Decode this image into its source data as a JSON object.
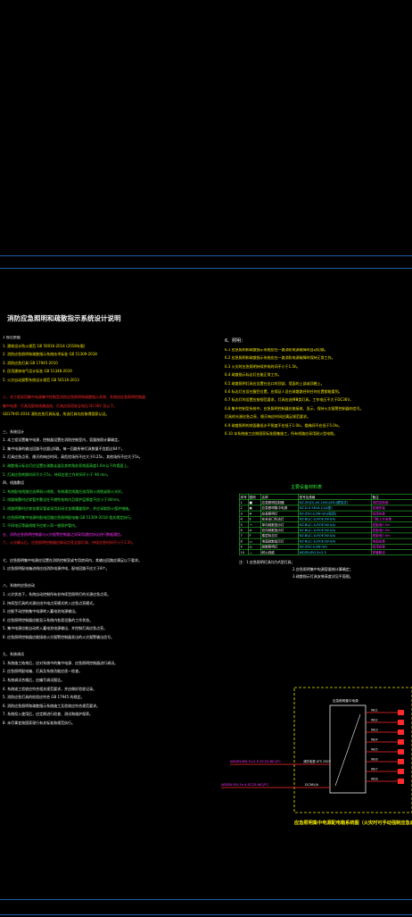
{
  "left_column": {
    "title": "消防应急照明和疏散指示系统设计说明",
    "lines": [
      {
        "text": "1 规范依据",
        "color": "w"
      },
      {
        "text": "1. 建筑设计防火规范 GB 50016-2014 (2018年版)",
        "color": "y"
      },
      {
        "text": "2. 消防应急照明和疏散指示系统技术标准 GB 51309-2018",
        "color": "y"
      },
      {
        "text": "3. 消防应急灯具 GB 17945-2010",
        "color": "y"
      },
      {
        "text": "4. 民用建筑电气设计标准 GB 51348-2019",
        "color": "y"
      },
      {
        "text": "5. 火灾自动报警系统设计规范 GB 50116-2013",
        "color": "y"
      },
      {
        "text": "",
        "color": "w"
      },
      {
        "text": "二、本工程采用集中电源集中控制型消防应急照明和疏散指示系统，系统由应急照明控制器",
        "color": "r"
      },
      {
        "text": "集中电源、灯具及配电线路组成，灯具应采用安全电压 DC36V 及以下。",
        "color": "r"
      },
      {
        "text": "GB17945-2010 消防应急灯具标准，所选灯具均应取得国家认证。",
        "color": "y"
      },
      {
        "text": "",
        "color": "w"
      },
      {
        "text": "三、系统设计",
        "color": "w"
      },
      {
        "text": "1. 本工程设置集中电源，控制器设置在消防控制室内，容量按照计算确定。",
        "color": "w"
      },
      {
        "text": "2. 集中电源的输出回路不应超过8路，每一回路所带灯具数量不宜超过64个。",
        "color": "w"
      },
      {
        "text": "3. 灯具应急点亮、熄灭的响应时间，高危险场所不应大于0.25s，其他场所不应大于5s。",
        "color": "w"
      },
      {
        "text": "4. 疏散指示标志灯应设置在疏散走道及其转角处距地面高度1.0m以下的墙面上。",
        "color": "g"
      },
      {
        "text": "5. 灯具应急转换时间不大于5s，持续应急工作时间不小于 90 min。",
        "color": "g"
      },
      {
        "text": "四、线路敷设",
        "color": "w"
      },
      {
        "text": "1. 系统配电线路应选择耐火线缆，系统通信线路应选用耐火线缆或耐火光纤。",
        "color": "g"
      },
      {
        "text": "2. 线路暗敷时应穿管并敷设在不燃性结构内且保护层厚度不应小于30mm。",
        "color": "g"
      },
      {
        "text": "3. 线路明敷时应穿金属导管或采用封闭式金属槽盒保护，并应采取防火保护措施。",
        "color": "g"
      },
      {
        "text": "4. 应急照明集中电源的配电回路应急照明配电箱 GB 51309-2018 相关规定执行。",
        "color": "g"
      },
      {
        "text": "5. 不同电压等级线缆不应穿入同一根保护管内。",
        "color": "g"
      },
      {
        "text": "五、消防应急照明控制器与火灾报警控制器之间采用通信协议进行数据通信。",
        "color": "m"
      },
      {
        "text": "六、火灾确认后，应急照明控制器应联动点亮全部灯具，持续应急时间不小于1.5h。",
        "color": "r"
      },
      {
        "text": "",
        "color": "w"
      },
      {
        "text": "七、应急照明集中电源应设置在消防控制室或专用房间内，其输出回路应满足以下要求。",
        "color": "w"
      },
      {
        "text": "1. 应急照明配电箱进线应由消防电源供电，配电回路不应大于8个。",
        "color": "w"
      },
      {
        "text": "",
        "color": "w"
      },
      {
        "text": "八、系统的应急启动",
        "color": "w"
      },
      {
        "text": "1. 火灾状态下，系统自动控制所有非持续型照明灯的光源应急点亮。",
        "color": "w"
      },
      {
        "text": "2. 持续型灯具的光源应由节电点亮模式转入应急点亮模式。",
        "color": "w"
      },
      {
        "text": "3. 应能手动控制集中电源转入蓄电池电源输出。",
        "color": "w"
      },
      {
        "text": "4. 应急照明控制器应能显示系统内各类设备的工作状态。",
        "color": "w"
      },
      {
        "text": "5. 集中电源应能自动转入蓄电池电源输出，并控制灯具应急点亮。",
        "color": "w"
      },
      {
        "text": "6. 应急照明控制器应能接收火灾报警控制器发出的火灾报警输出信号。",
        "color": "w"
      },
      {
        "text": "",
        "color": "w"
      },
      {
        "text": "九、系统调试",
        "color": "w"
      },
      {
        "text": "1. 系统施工结束后，应对系统中的集中电源、应急照明控制器进行调试。",
        "color": "w"
      },
      {
        "text": "2. 应急照明配电箱、灯具及系统功能应逐一检查。",
        "color": "w"
      },
      {
        "text": "3. 系统调试合格后，应编写调试报告。",
        "color": "w"
      },
      {
        "text": "4. 系统竣工验收应符合相关规范要求，并应做好验收记录。",
        "color": "w"
      },
      {
        "text": "5. 消防应急灯具的检验应符合 GB 17945 的规定。",
        "color": "w"
      },
      {
        "text": "6. 消防应急照明和疏散指示系统施工及验收应符合规范要求。",
        "color": "w"
      },
      {
        "text": "7. 系统投入使用后，应定期进行检查、测试和维护保养。",
        "color": "w"
      },
      {
        "text": "8. 未尽事宜按国家现行有关标准和规范执行。",
        "color": "w"
      }
    ]
  },
  "right_column": {
    "heading": "6、照明：",
    "lines": [
      {
        "text": "6.1 应急照明和疏散指示系统应在一路消防电源故障时自动切换。",
        "color": "y"
      },
      {
        "text": "6.2 应急照明和疏散指示系统应在一路消防电源故障时保持正常工作。",
        "color": "y"
      },
      {
        "text": "6.3 火灾时应急照明持续供电时间不小于1.5h。",
        "color": "y"
      },
      {
        "text": "6.4 疏散指示标志灯应能正常工作。",
        "color": "y"
      },
      {
        "text": "6.5 疏散照明灯具应设置在出口的顶部、墙面的上部或顶棚上。",
        "color": "y"
      },
      {
        "text": "6.6 标志灯应设在醒目位置，应保证人员在疏散路径的任何位置都能看到。",
        "color": "y"
      },
      {
        "text": "6.7 标志灯的设置应按规范要求，灯具应选择Ⅲ类灯具，工作电压不大于DC36V。",
        "color": "y"
      },
      {
        "text": "6.8 集中控制型系统中，应急照明控制器应能接收、显示、保持火灾报警控制器的信号。",
        "color": "y"
      },
      {
        "text": "   灯具的光源应急点亮、熄灭响应时间应满足规范要求。",
        "color": "y"
      },
      {
        "text": "6.9 疏散照明的地面最低水平照度不应低于1.0lx，楼梯间不应低于5.0lx。",
        "color": "y"
      },
      {
        "text": "6.10 本系统施工应按国家标准图集施工，所有线路应采用耐火型电缆。",
        "color": "y"
      }
    ]
  },
  "table": {
    "title": "主要设备材料表",
    "headers": [
      "序号",
      "图例",
      "名称",
      "型号及规格",
      "备注"
    ],
    "rows": [
      [
        "1",
        "■",
        "应急照明控制器",
        "NZ-ZK(D)-AS-2000(ZD)(壁挂式)",
        "消防控制室"
      ],
      [
        "2",
        "▣",
        "应急照明集中电源",
        "NZ-D-0.5KVA-(Ⅰ)(A型)",
        "挂墙安装"
      ],
      [
        "3",
        "⊗",
        "应急照明灯",
        "NZ-ZFJC-E3W-Ⅰ(A)(吸顶)",
        "吸顶安装"
      ],
      [
        "4",
        "E",
        "安全出口标志灯",
        "NZ-BLJC-1LROE1W-Ⅰ(A)",
        "门框上方安装"
      ],
      [
        "5",
        "→",
        "单向疏散指示灯",
        "NZ-BLJC-1LROE1W-Ⅰ(A)",
        "底距地0.5m"
      ],
      [
        "6",
        "⇄",
        "双向疏散指示灯",
        "NZ-BLJC-1LROE1W-Ⅰ(A)",
        "底距地0.5m"
      ],
      [
        "7",
        "F",
        "楼层标志灯",
        "NZ-BLJC-1LROE1W-Ⅰ(A)",
        "底距地2.5m"
      ],
      [
        "8",
        "▭",
        "地面疏散指示灯",
        "NZ-BLJC-1LROE1W-Ⅰ(A)",
        "地面安装"
      ],
      [
        "9",
        "◎",
        "疏散照明灯",
        "NZ-ZFJC-E3W-Ⅰ(A)",
        "吸顶安装"
      ],
      [
        "10",
        "—",
        "耐火线缆",
        "WDZN-BYJ-3×2.5",
        "穿管敷设"
      ]
    ]
  },
  "notes": [
    "注：1.应急照明灯具均为A型灯具；",
    "2.应急照明集中电源容量按计算确定；",
    "3.疏散指示灯具安装高度详见平面图。"
  ],
  "diagram": {
    "box_label": "应急照明集中电源",
    "left_label_1": "WDZN-BYJ-3×2.5-SC20-WC/FC",
    "left_label_2": "消防电源 ATS 250V",
    "bottom_label_1": "WDZN-YJV-3×4-SC25-WC/FC",
    "bottom_label_2": "DC36V/A",
    "circuit_labels": [
      "WE1",
      "WE2",
      "WE3",
      "WE4",
      "WE5",
      "WE6",
      "WE7",
      "WE8"
    ],
    "caption": "应急照明集中电源配电箱系统图（火灾时可手动强制应急启动）"
  }
}
